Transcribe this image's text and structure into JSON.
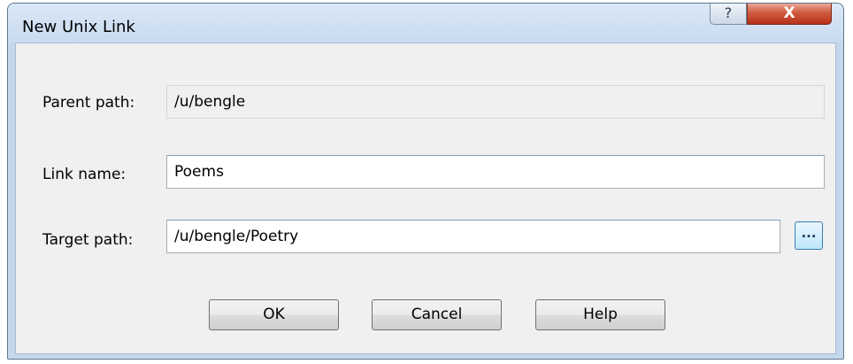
{
  "window": {
    "title": "New Unix Link",
    "help_glyph": "?",
    "close_glyph": "X"
  },
  "form": {
    "parent_path_label": "Parent path:",
    "parent_path_value": "/u/bengle",
    "link_name_label": "Link name:",
    "link_name_value": "Poems",
    "target_path_label": "Target path:",
    "target_path_value": "/u/bengle/Poetry",
    "browse_label": "..."
  },
  "buttons": {
    "ok": "OK",
    "cancel": "Cancel",
    "help": "Help"
  },
  "icons": {
    "help": "help-icon",
    "close": "close-icon",
    "browse": "ellipsis-icon"
  },
  "colors": {
    "frame": "#c4d8ec",
    "client": "#f0f0f0",
    "close_button": "#c7432a",
    "browse_accent": "#3c7fb1"
  }
}
